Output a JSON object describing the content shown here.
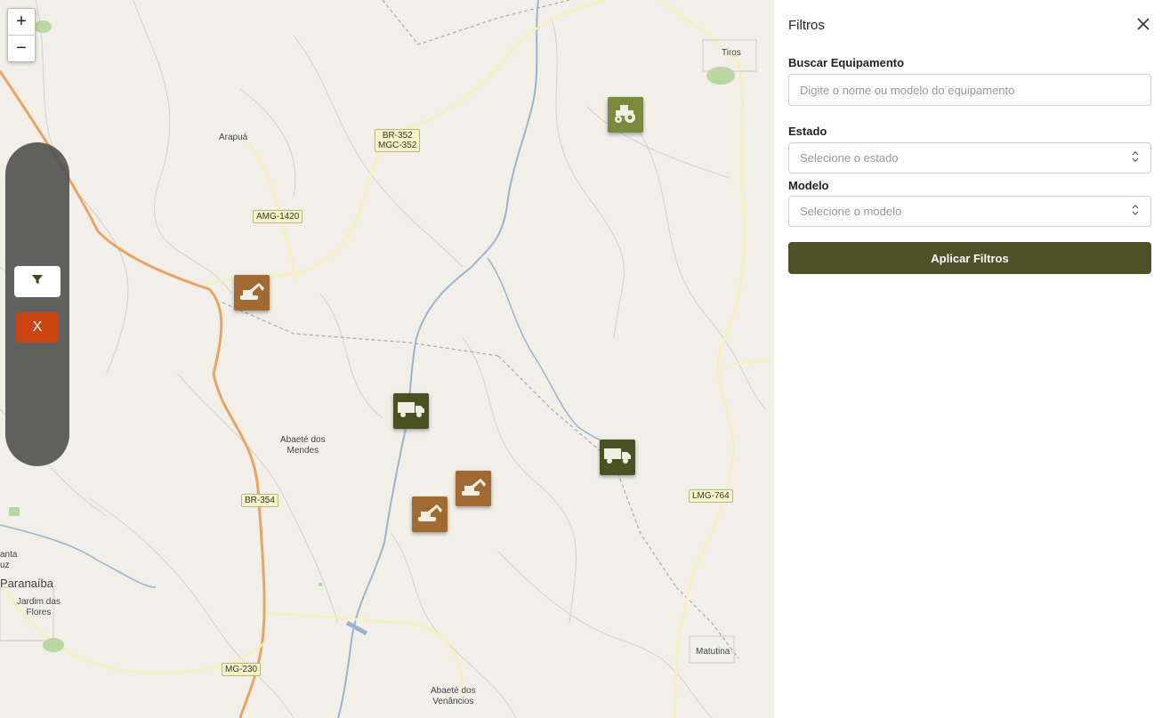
{
  "map": {
    "zoom_in": "+",
    "zoom_out": "−",
    "places": {
      "tiros": "Tiros",
      "arapua": "Arapuá",
      "abaete_mendes_1": "Abaeté dos",
      "abaete_mendes_2": "Mendes",
      "santa": "anta",
      "uz": "uz",
      "paranaiba": "Paranaíba",
      "jardim_1": "Jardim das",
      "jardim_2": "Flores",
      "matutina": "Matutina",
      "abaete_venancios_1": "Abaeté dos",
      "abaete_venancios_2": "Venâncios"
    },
    "roads": {
      "br352_1": "BR-352",
      "br352_2": "MGC-352",
      "amg1420": "AMG-1420",
      "br354": "BR-354",
      "lmg764": "LMG-764",
      "mg230": "MG-230"
    },
    "close_label": "X",
    "markers": [
      {
        "type": "tractor",
        "color": "#7a8a3c"
      },
      {
        "type": "excavator",
        "color": "#a06a32"
      },
      {
        "type": "truck",
        "color": "#4a5224"
      },
      {
        "type": "truck",
        "color": "#4a5224"
      },
      {
        "type": "excavator",
        "color": "#a06a32"
      },
      {
        "type": "excavator",
        "color": "#a06a32"
      }
    ]
  },
  "filters": {
    "title": "Filtros",
    "search_label": "Buscar Equipamento",
    "search_placeholder": "Digite o nome ou modelo do equipamento",
    "state_label": "Estado",
    "state_placeholder": "Selecione o estado",
    "model_label": "Modelo",
    "model_placeholder": "Selecione o modelo",
    "apply_label": "Aplicar Filtros",
    "accent_color": "#4f5229",
    "close_color": "#cc4411"
  }
}
